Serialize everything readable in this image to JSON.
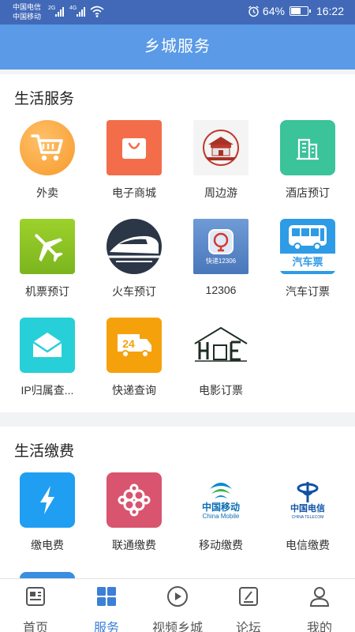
{
  "status": {
    "carrier1": "中国电信",
    "carrier2": "中国移动",
    "net1": "2G",
    "net2": "4G",
    "battery": "64%",
    "battery_level": 0.64,
    "time": "16:22"
  },
  "header": {
    "title": "乡城服务"
  },
  "life_services": {
    "title": "生活服务",
    "items": [
      {
        "label": "外卖",
        "icon": "cart-icon"
      },
      {
        "label": "电子商城",
        "icon": "shopping-bag-icon"
      },
      {
        "label": "周边游",
        "icon": "gate-tower-icon"
      },
      {
        "label": "酒店预订",
        "icon": "building-icon"
      },
      {
        "label": "机票预订",
        "icon": "airplane-icon"
      },
      {
        "label": "火车预订",
        "icon": "train-icon"
      },
      {
        "label": "12306",
        "icon": "railway-12306-icon",
        "icon_text": "快递12306"
      },
      {
        "label": "汽车订票",
        "icon": "bus-icon",
        "icon_text": "汽车票"
      },
      {
        "label": "IP归属查...",
        "icon": "envelope-icon"
      },
      {
        "label": "快递查询",
        "icon": "delivery-truck-icon",
        "icon_text": "24"
      },
      {
        "label": "电影订票",
        "icon": "house-logo-icon"
      }
    ]
  },
  "payments": {
    "title": "生活缴费",
    "items": [
      {
        "label": "缴电费",
        "icon": "lightning-icon"
      },
      {
        "label": "联通缴费",
        "icon": "unicom-knot-icon"
      },
      {
        "label": "移动缴费",
        "icon": "china-mobile-icon",
        "icon_text": "中国移动",
        "icon_sub": "China Mobile"
      },
      {
        "label": "电信缴费",
        "icon": "china-telecom-icon",
        "icon_text": "中国电信",
        "icon_sub": "CHINA TELECOM"
      }
    ]
  },
  "tabbar": {
    "items": [
      {
        "label": "首页",
        "icon": "news-icon"
      },
      {
        "label": "服务",
        "icon": "grid-icon",
        "active": true
      },
      {
        "label": "视频乡城",
        "icon": "play-icon"
      },
      {
        "label": "论坛",
        "icon": "edit-icon"
      },
      {
        "label": "我的",
        "icon": "user-icon"
      }
    ]
  },
  "colors": {
    "status_bar": "#4169b8",
    "title_bar": "#5a9ae6",
    "active_tab": "#3c7fd6"
  }
}
